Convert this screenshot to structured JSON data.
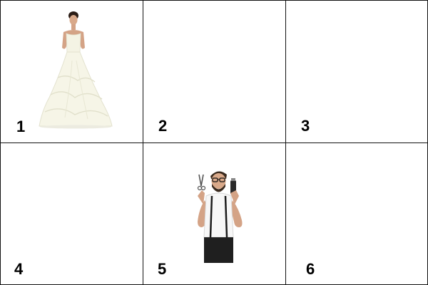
{
  "grid": {
    "cells": [
      {
        "number": "1",
        "image": "bride-in-wedding-dress"
      },
      {
        "number": "2",
        "image": null
      },
      {
        "number": "3",
        "image": null
      },
      {
        "number": "4",
        "image": null
      },
      {
        "number": "5",
        "image": "barber-with-scissors-and-clipper"
      },
      {
        "number": "6",
        "image": null
      }
    ]
  },
  "colors": {
    "grid_line": "#111111",
    "background": "#ffffff",
    "label": "#000000"
  }
}
